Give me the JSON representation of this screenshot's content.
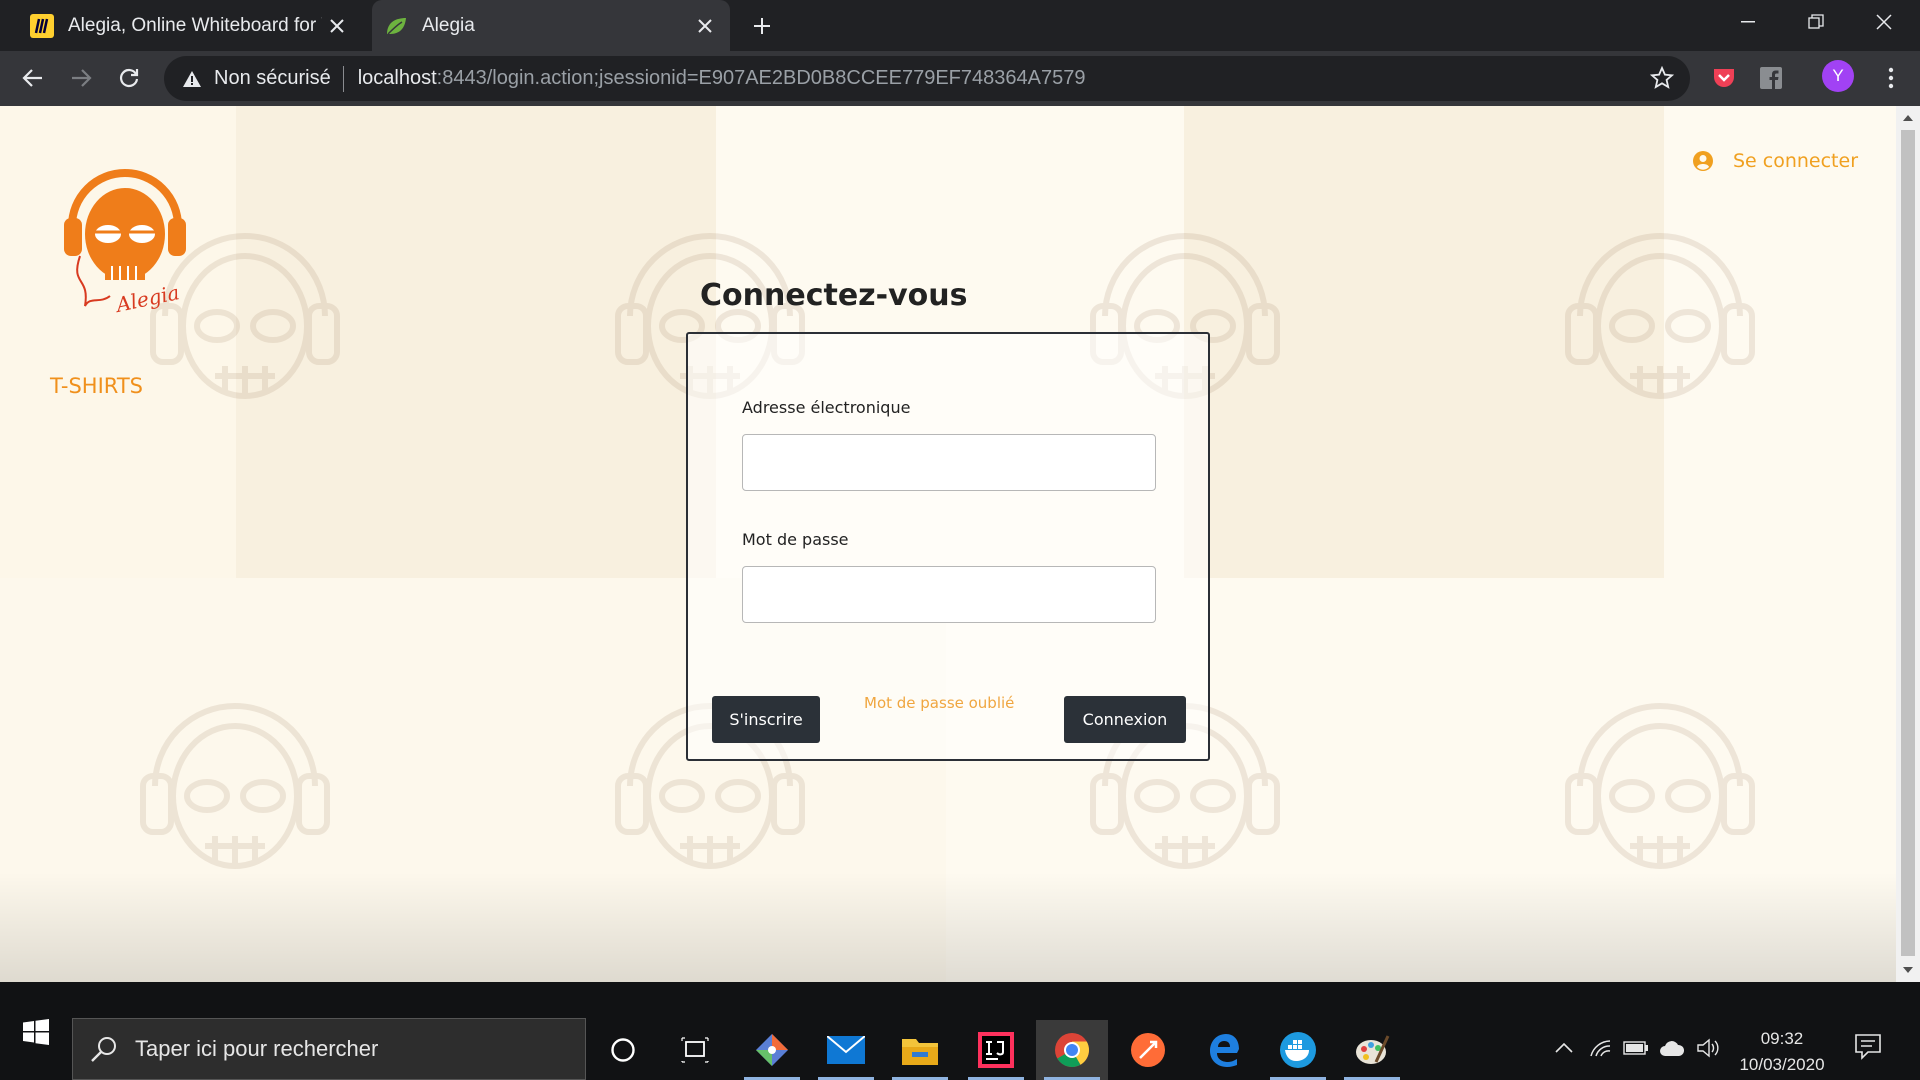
{
  "browser": {
    "tabs": [
      {
        "title": "Alegia, Online Whiteboard for Vi",
        "favicon": "miro-icon",
        "active": false
      },
      {
        "title": "Alegia",
        "favicon": "spring-leaf-icon",
        "active": true
      }
    ],
    "address": {
      "security_text": "Non sécurisé",
      "host": "localhost",
      "path": ":8443/login.action;jsessionid=E907AE2BD0B8CCEE779EF748364A7579"
    },
    "profile_initial": "Y"
  },
  "page": {
    "nav": {
      "tshirts_label": "T-SHIRTS",
      "login_link": "Se connecter"
    },
    "heading": "Connectez-vous",
    "form": {
      "email_label": "Adresse électronique",
      "email_value": "",
      "password_label": "Mot de passe",
      "password_value": "",
      "signup_button": "S'inscrire",
      "forgot_link": "Mot de passe oublié",
      "submit_button": "Connexion"
    },
    "logo_text": "Alegia",
    "colors": {
      "accent": "#f0901c",
      "button": "#2b3138",
      "background": "#fef9ee"
    }
  },
  "taskbar": {
    "search_placeholder": "Taper ici pour rechercher",
    "time": "09:32",
    "date": "10/03/2020"
  }
}
